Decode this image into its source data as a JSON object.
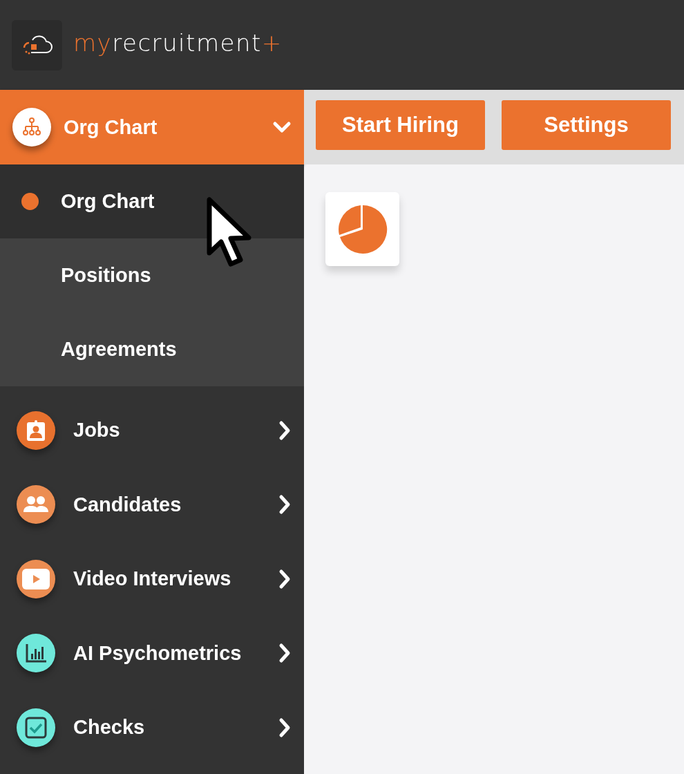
{
  "header": {
    "logo": [
      {
        "text": "my",
        "accent": true
      },
      {
        "text": "recruitment",
        "accent": false
      },
      {
        "text": "+",
        "accent": true
      }
    ]
  },
  "sidebar": {
    "group": {
      "label": "Org Chart",
      "expanded": true,
      "children": [
        {
          "label": "Org Chart",
          "selected": true
        },
        {
          "label": "Positions",
          "selected": false
        },
        {
          "label": "Agreements",
          "selected": false
        }
      ]
    },
    "items": [
      {
        "label": "Jobs",
        "color": "#e8712e"
      },
      {
        "label": "Candidates",
        "color": "#ec8d52"
      },
      {
        "label": "Video Interviews",
        "color": "#ec8d52"
      },
      {
        "label": "AI Psychometrics",
        "color": "#6fe8da"
      },
      {
        "label": "Checks",
        "color": "#6fe8da"
      }
    ]
  },
  "toolbar": {
    "buttons": [
      "Start Hiring",
      "Settings"
    ]
  }
}
